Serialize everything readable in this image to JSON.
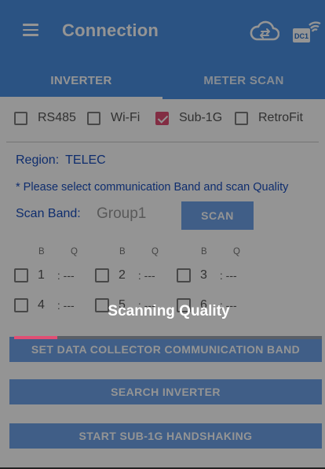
{
  "app_bar": {
    "title": "Connection",
    "menu_icon": "hamburger-menu-icon",
    "cloud_icon": "cloud-sync-icon",
    "dc_icon": "dc1-wifi-icon",
    "dc_label": "DC1"
  },
  "tabs": [
    {
      "label": "INVERTER",
      "active": true
    },
    {
      "label": "METER SCAN",
      "active": false
    }
  ],
  "protocols": [
    {
      "label": "RS485",
      "checked": false
    },
    {
      "label": "Wi-Fi",
      "checked": false
    },
    {
      "label": "Sub-1G",
      "checked": true
    },
    {
      "label": "RetroFit",
      "checked": false
    }
  ],
  "region": {
    "label": "Region:",
    "value": "TELEC"
  },
  "hint": "* Please select communication Band and scan Quality",
  "scan_band": {
    "label": "Scan Band:",
    "value": "Group1",
    "button": "SCAN"
  },
  "band_columns": {
    "b": "B",
    "q": "Q"
  },
  "groups": [
    {
      "num": "1",
      "quality": ": ---"
    },
    {
      "num": "2",
      "quality": ": ---"
    },
    {
      "num": "3",
      "quality": ": ---"
    },
    {
      "num": "4",
      "quality": ": ---"
    },
    {
      "num": "5",
      "quality": ": ---"
    },
    {
      "num": "6",
      "quality": ": ---"
    }
  ],
  "buttons": {
    "set_band": "SET DATA COLLECTOR COMMUNICATION BAND",
    "search": "SEARCH INVERTER",
    "handshake": "START SUB-1G HANDSHAKING"
  },
  "overlay": {
    "message": "Scanning Quality",
    "progress": 0.14
  },
  "colors": {
    "primary": "#4a90e2",
    "accent": "#e04f74",
    "text_blue": "#1a4fbd"
  }
}
